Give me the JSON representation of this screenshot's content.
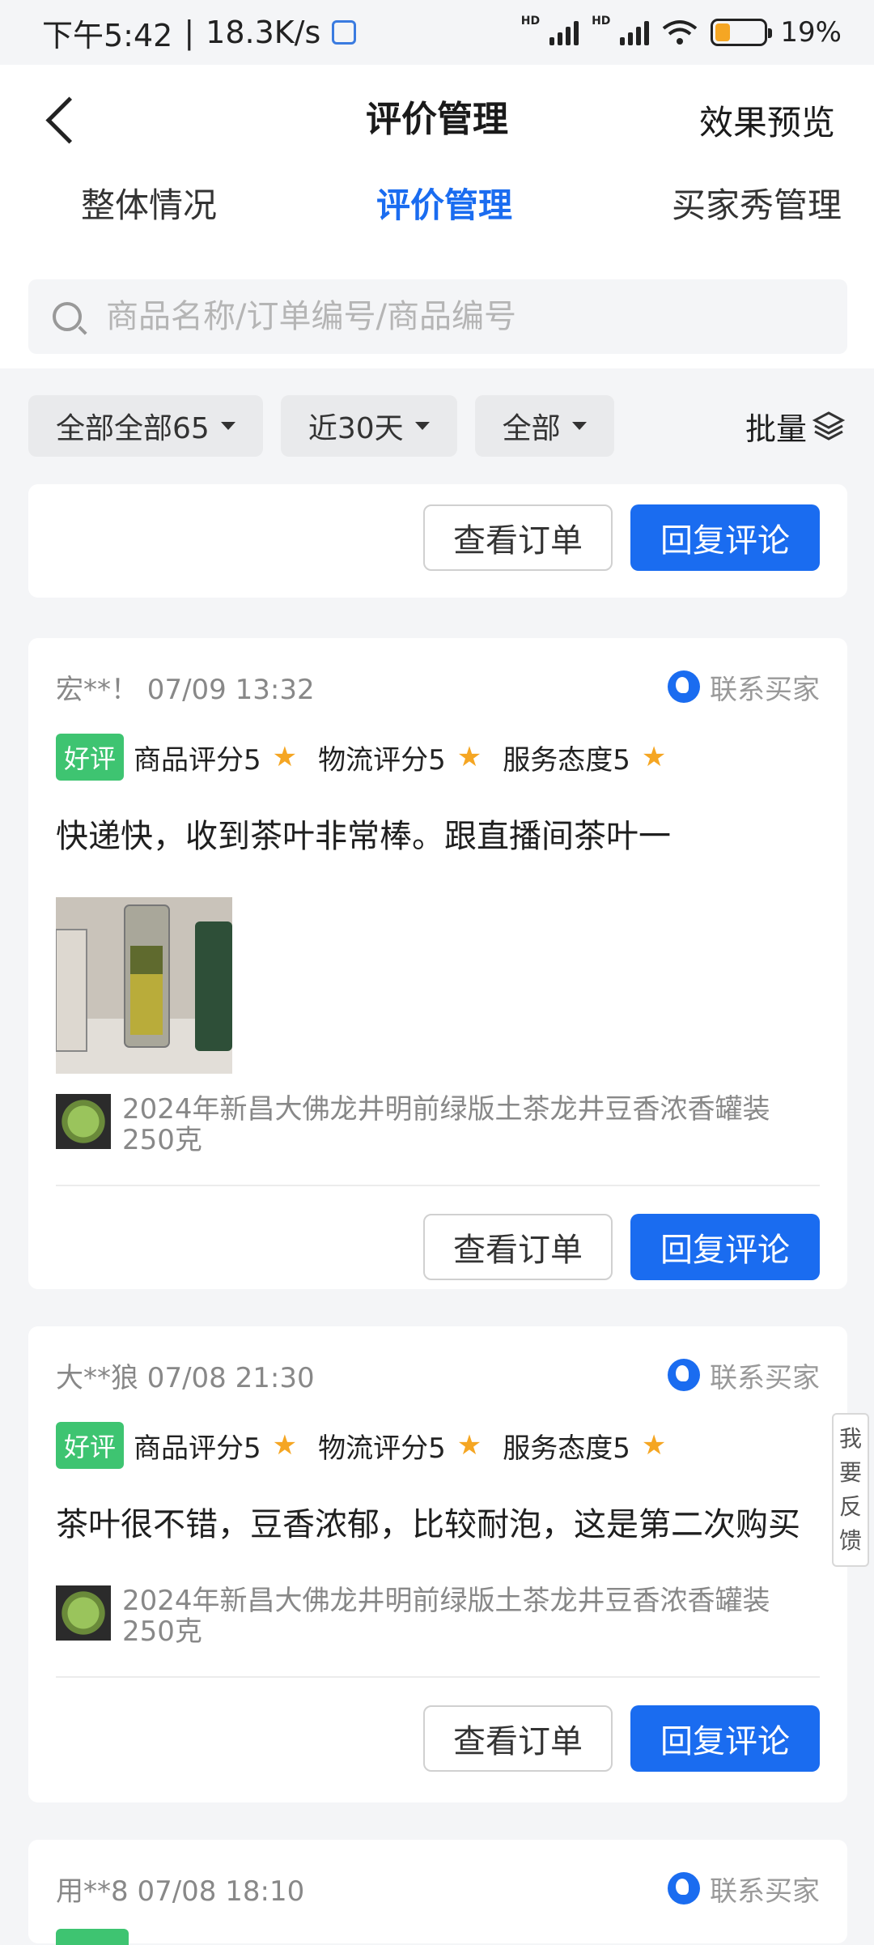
{
  "status_bar": {
    "time": "下午5:42",
    "separator": "|",
    "net_speed": "18.3K/s",
    "battery": "19%",
    "hd1": "HD",
    "hd2": "HD"
  },
  "nav": {
    "title": "评价管理",
    "preview": "效果预览"
  },
  "tabs": [
    {
      "label": "整体情况"
    },
    {
      "label": "评价管理"
    },
    {
      "label": "买家秀管理"
    }
  ],
  "search": {
    "placeholder": "商品名称/订单编号/商品编号"
  },
  "filters": [
    {
      "label": "全部全部65"
    },
    {
      "label": "近30天"
    },
    {
      "label": "全部"
    }
  ],
  "batch_label": "批量",
  "buttons": {
    "view_order": "查看订单",
    "reply": "回复评论"
  },
  "contact_label": "联系买家",
  "reviews": [
    {
      "buyer": "宏**！ 07/09 13:32",
      "badge": "好评",
      "ratings": [
        "商品评分5",
        "物流评分5",
        "服务态度5"
      ],
      "comment": "快递快，收到茶叶非常棒。跟直播间茶叶一",
      "product_line1": "2024年新昌大佛龙井明前绿版土茶龙井豆香浓香罐装",
      "product_line2": "250克"
    },
    {
      "buyer": "大**狼 07/08 21:30",
      "badge": "好评",
      "ratings": [
        "商品评分5",
        "物流评分5",
        "服务态度5"
      ],
      "comment": "茶叶很不错，豆香浓郁，比较耐泡，这是第二次购买",
      "product_line1": "2024年新昌大佛龙井明前绿版土茶龙井豆香浓香罐装",
      "product_line2": "250克"
    },
    {
      "buyer": "用**8 07/08 18:10"
    }
  ],
  "feedback": [
    "我",
    "要",
    "反",
    "馈"
  ],
  "colors": {
    "accent": "#1a6cf0",
    "good_badge": "#3ec471",
    "star": "#f5a623"
  }
}
